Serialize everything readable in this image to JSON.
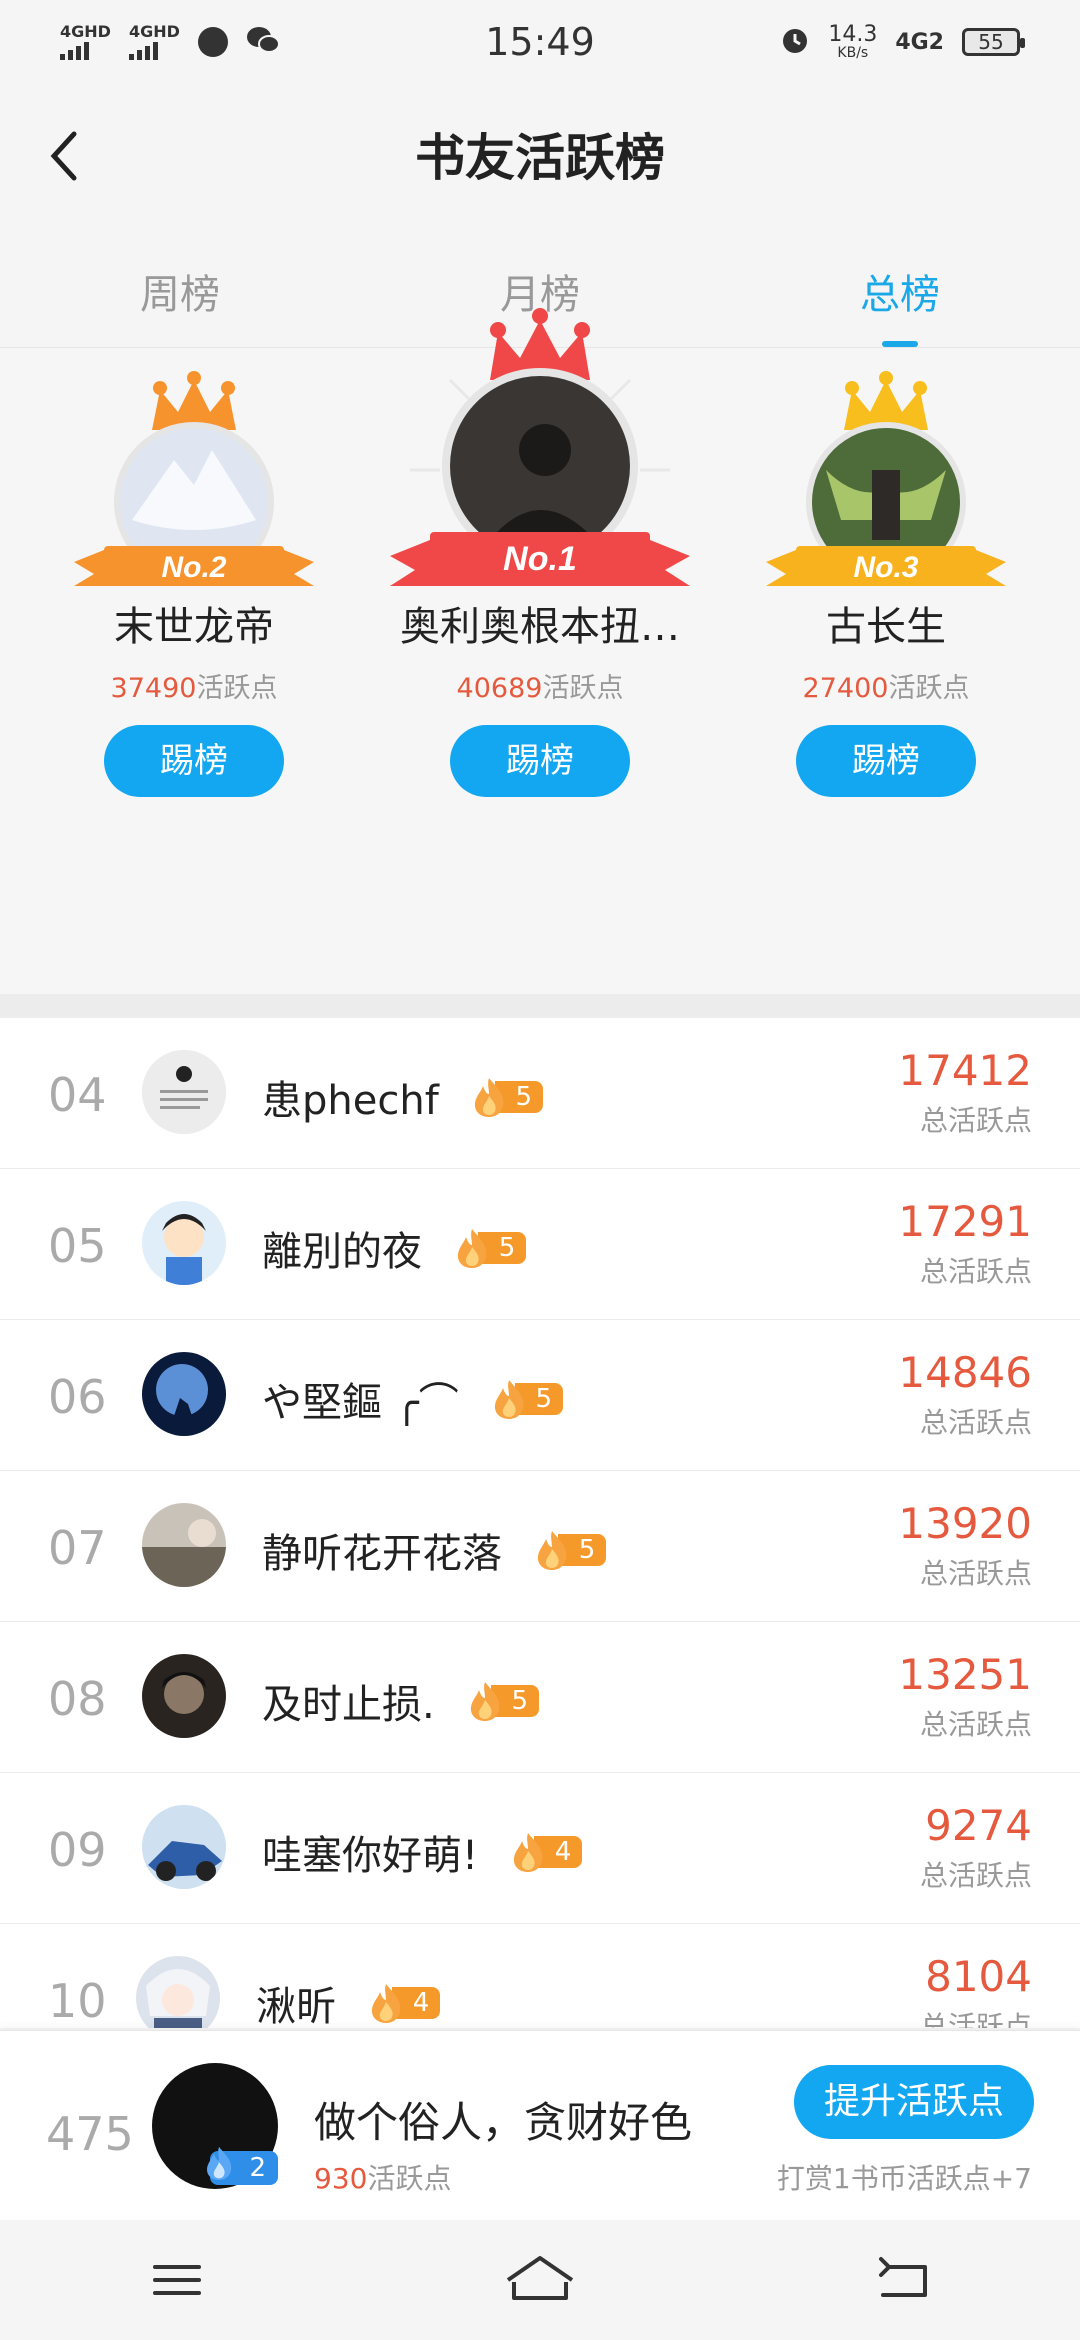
{
  "status_bar": {
    "time": "15:49",
    "signal1": "4GHD",
    "signal2": "4GHD",
    "net_speed": "14.3",
    "net_unit": "KB/s",
    "net_type": "4G2",
    "battery": "55"
  },
  "header": {
    "title": "书友活跃榜"
  },
  "tabs": [
    {
      "label": "周榜",
      "active": false
    },
    {
      "label": "月榜",
      "active": false
    },
    {
      "label": "总榜",
      "active": true
    }
  ],
  "podium": {
    "points_suffix": "活跃点",
    "kick_label": "踢榜",
    "first": {
      "badge": "No.1",
      "name": "奥利奥根本扭…",
      "points": "40689"
    },
    "second": {
      "badge": "No.2",
      "name": "末世龙帝",
      "points": "37490"
    },
    "third": {
      "badge": "No.3",
      "name": "古长生",
      "points": "27400"
    }
  },
  "ranking": {
    "score_label": "总活跃点",
    "rows": [
      {
        "rank": "04",
        "name": "患phechf",
        "level": "5",
        "score": "17412"
      },
      {
        "rank": "05",
        "name": "離別的夜",
        "level": "5",
        "score": "17291"
      },
      {
        "rank": "06",
        "name": "や堅鏂 ╭⌒",
        "level": "5",
        "score": "14846"
      },
      {
        "rank": "07",
        "name": "静听花开花落",
        "level": "5",
        "score": "13920"
      },
      {
        "rank": "08",
        "name": "及时止损.",
        "level": "5",
        "score": "13251"
      },
      {
        "rank": "09",
        "name": "哇塞你好萌!",
        "level": "4",
        "score": "9274"
      },
      {
        "rank": "10",
        "name": "湫昕",
        "level": "4",
        "score": "8104"
      }
    ]
  },
  "my_rank": {
    "rank": "475",
    "name": "做个俗人，贪财好色",
    "level": "2",
    "points": "930",
    "points_suffix": "活跃点",
    "boost_label": "提升活跃点",
    "boost_note": "打赏1书币活跃点+7"
  },
  "colors": {
    "accent": "#12a7f0",
    "score": "#e55a3e",
    "badge": "#f59a2a"
  }
}
